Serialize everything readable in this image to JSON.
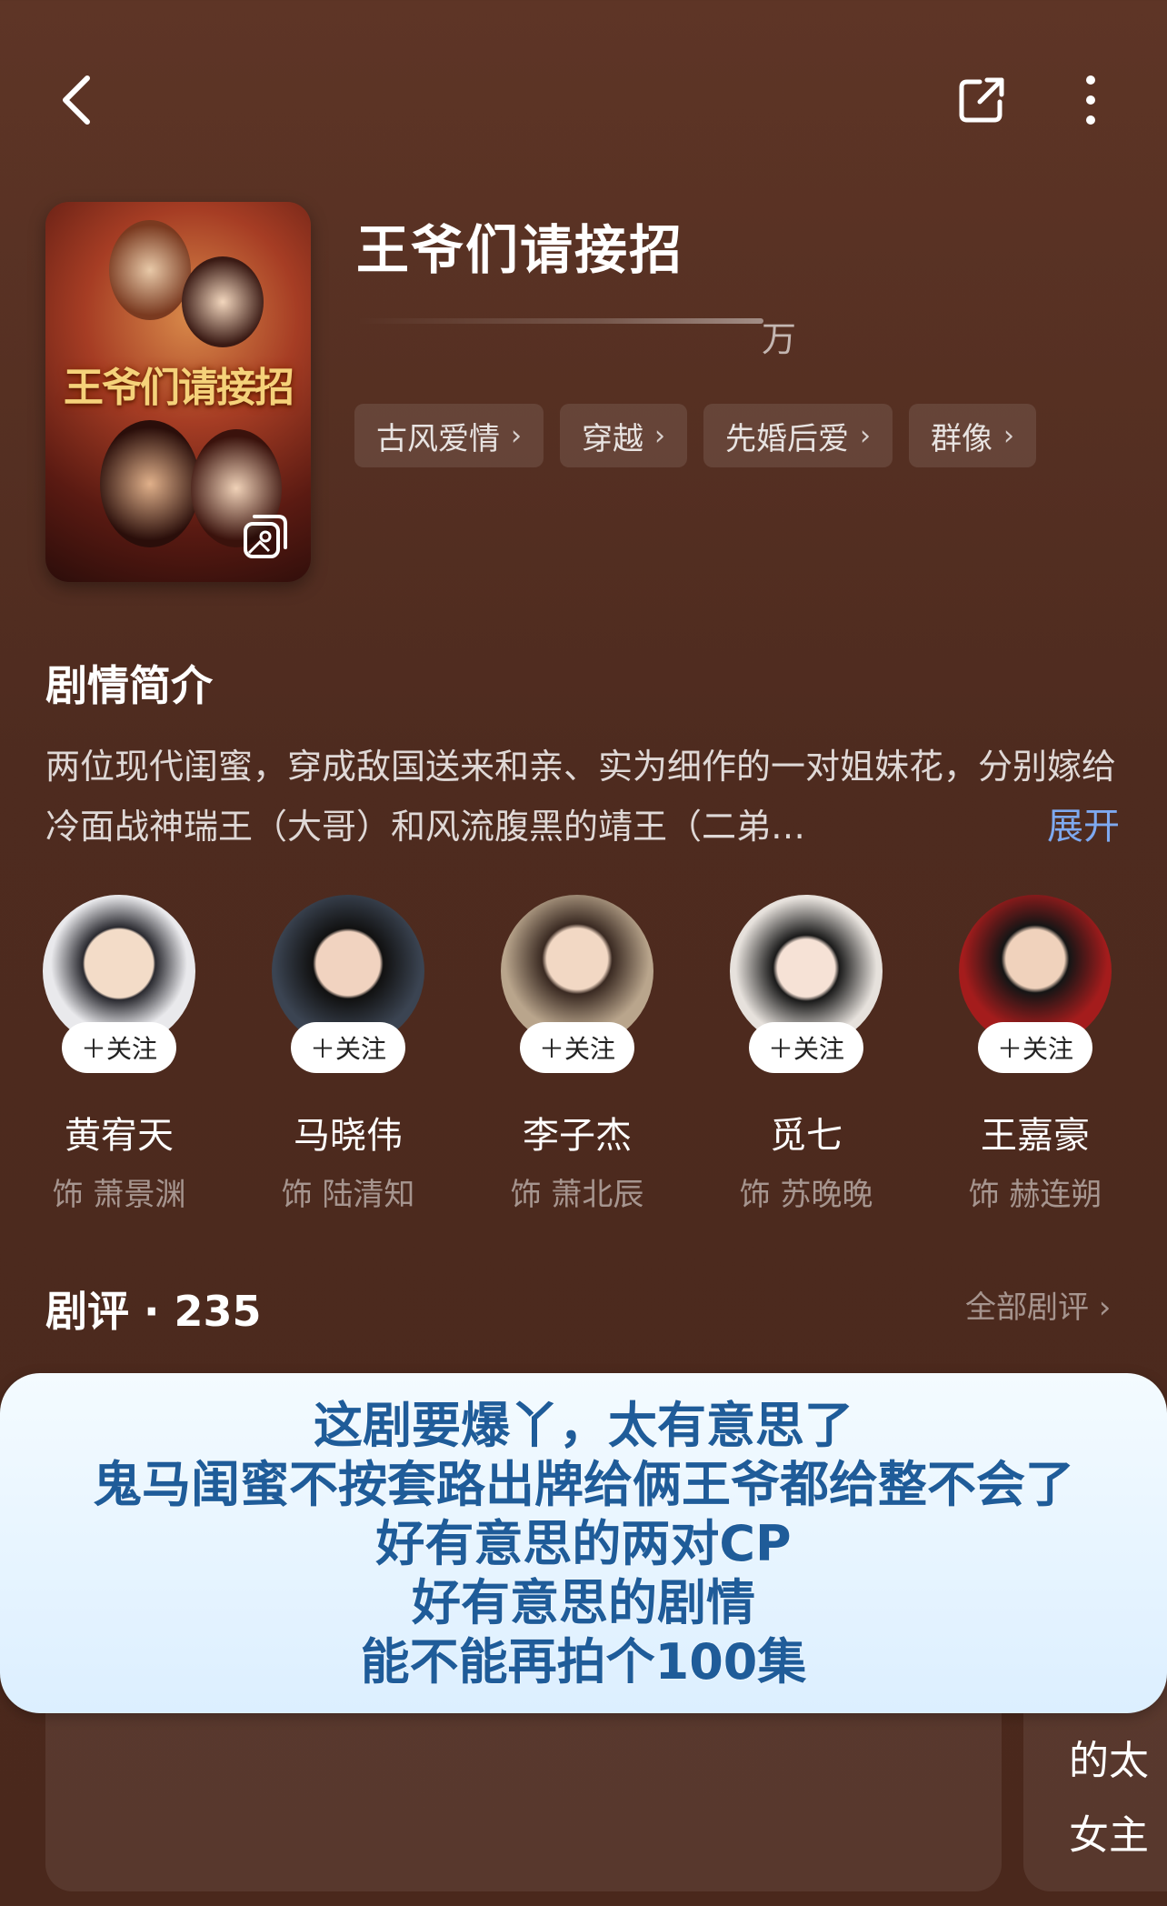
{
  "header": {
    "back_icon": "chevron-left-icon",
    "share_icon": "share-icon",
    "more_icon": "more-vertical-icon"
  },
  "drama": {
    "title": "王爷们请接招",
    "poster_text": "王爷们请接招",
    "heat_unit": "万",
    "tags": [
      {
        "label": "古风爱情"
      },
      {
        "label": "穿越"
      },
      {
        "label": "先婚后爱"
      },
      {
        "label": "群像"
      }
    ]
  },
  "synopsis": {
    "heading": "剧情简介",
    "text": "两位现代闺蜜，穿成敌国送来和亲、实为细作的一对姐妹花，分别嫁给冷面战神瑞王（大哥）和风流腹黑的靖王（二弟…",
    "expand_label": "展开"
  },
  "cast": [
    {
      "name": "黄宥天",
      "role": "饰 萧景渊",
      "follow": "＋关注",
      "bg": "#e9e9ec"
    },
    {
      "name": "马晓伟",
      "role": "饰 陆清知",
      "follow": "＋关注",
      "bg": "#3b4452"
    },
    {
      "name": "李子杰",
      "role": "饰 萧北辰",
      "follow": "＋关注",
      "bg": "#b9a58c"
    },
    {
      "name": "觅七",
      "role": "饰 苏晚晚",
      "follow": "＋关注",
      "bg": "#e6e1dc"
    },
    {
      "name": "王嘉豪",
      "role": "饰 赫连朔",
      "follow": "＋关注",
      "bg": "#a41c1c"
    }
  ],
  "reviews": {
    "heading": "剧评 · 235",
    "all_label": "全部剧评 ›",
    "card2_line1": "的太",
    "card2_line2": "女主"
  },
  "caption": {
    "lines": [
      "这剧要爆丫，太有意思了",
      "鬼马闺蜜不按套路出牌给俩王爷都给整不会了",
      "好有意思的两对CP",
      "好有意思的剧情",
      "能不能再拍个100集"
    ]
  }
}
